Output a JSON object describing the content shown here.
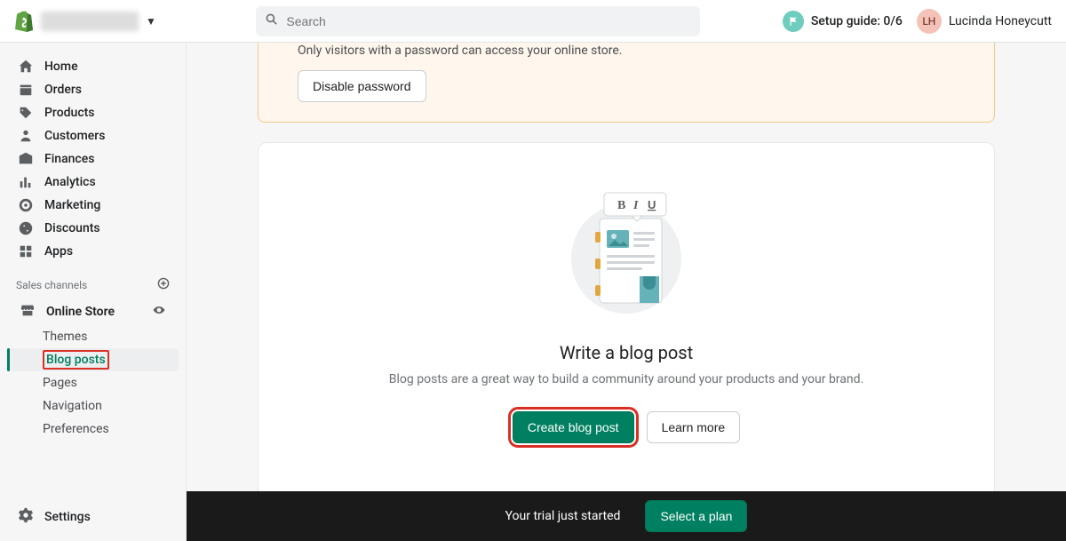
{
  "header": {
    "search_placeholder": "Search",
    "setup_guide_label": "Setup guide: 0/6",
    "user_initials": "LH",
    "user_name": "Lucinda Honeycutt"
  },
  "sidebar": {
    "items": [
      {
        "label": "Home",
        "icon": "home"
      },
      {
        "label": "Orders",
        "icon": "orders"
      },
      {
        "label": "Products",
        "icon": "products"
      },
      {
        "label": "Customers",
        "icon": "customers"
      },
      {
        "label": "Finances",
        "icon": "finances"
      },
      {
        "label": "Analytics",
        "icon": "analytics"
      },
      {
        "label": "Marketing",
        "icon": "marketing"
      },
      {
        "label": "Discounts",
        "icon": "discounts"
      },
      {
        "label": "Apps",
        "icon": "apps"
      }
    ],
    "sales_channels_label": "Sales channels",
    "online_store_label": "Online Store",
    "sub_items": [
      {
        "label": "Themes"
      },
      {
        "label": "Blog posts",
        "active": true
      },
      {
        "label": "Pages"
      },
      {
        "label": "Navigation"
      },
      {
        "label": "Preferences"
      }
    ],
    "settings_label": "Settings"
  },
  "banner": {
    "text": "Only visitors with a password can access your online store.",
    "button_label": "Disable password"
  },
  "card": {
    "title": "Write a blog post",
    "description": "Blog posts are a great way to build a community around your products and your brand.",
    "create_label": "Create blog post",
    "learn_label": "Learn more"
  },
  "bottombar": {
    "message": "Your trial just started",
    "button_label": "Select a plan"
  }
}
